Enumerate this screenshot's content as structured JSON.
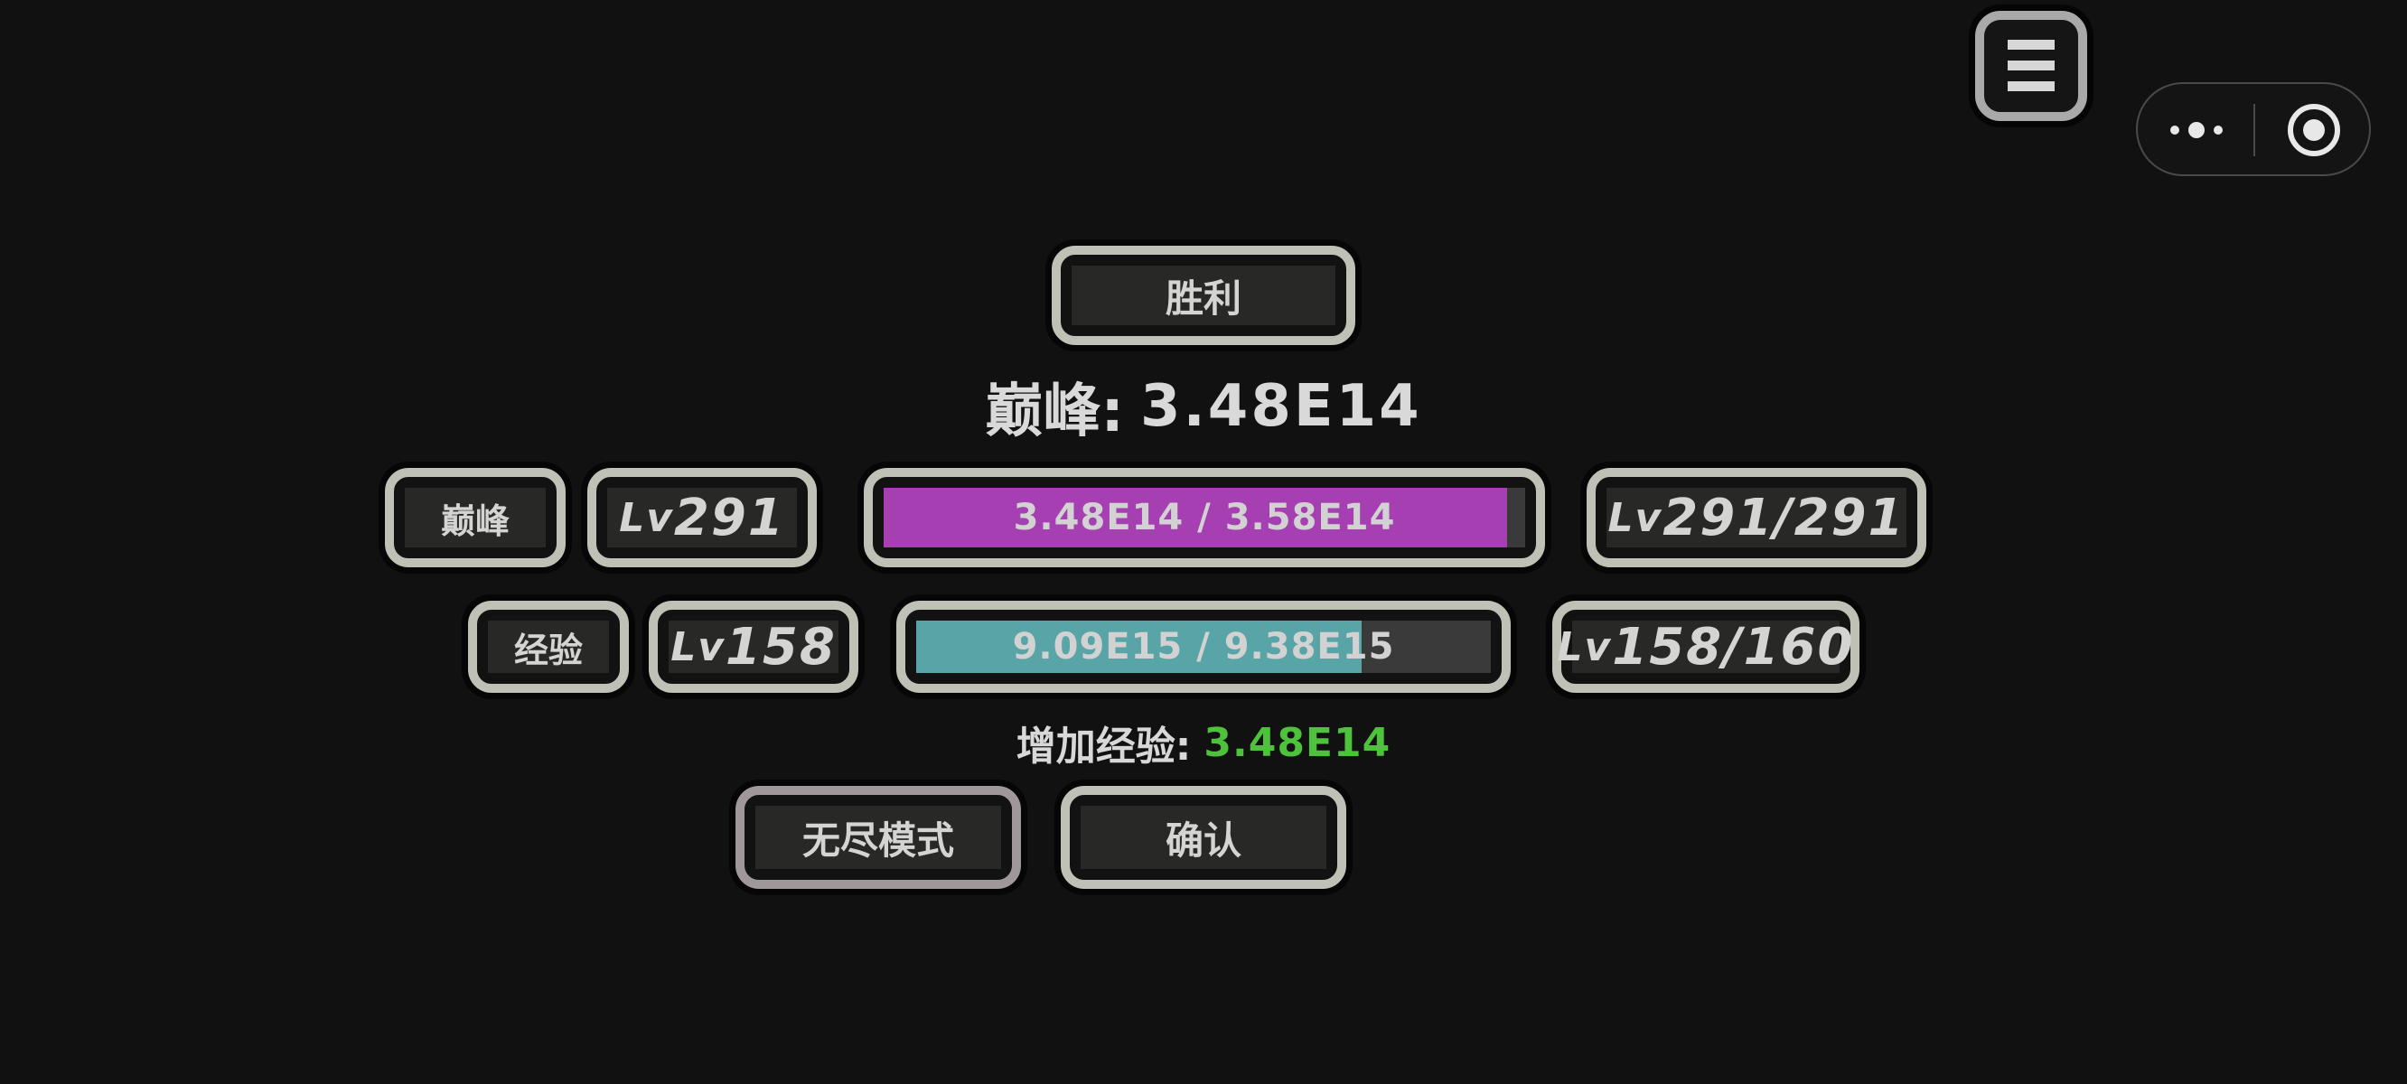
{
  "result_title": "胜利",
  "summary": {
    "label": "巅峰:",
    "value": "3.48E14"
  },
  "rows": [
    {
      "label": "巅峰",
      "level": "291",
      "progress_text": "3.48E14 / 3.58E14",
      "progress_ratio": 0.972,
      "level_range": "291/291",
      "fill_color": "#a63fb1"
    },
    {
      "label": "经验",
      "level": "158",
      "progress_text": "9.09E15 / 9.38E15",
      "progress_ratio": 0.775,
      "level_range": "158/160",
      "fill_color": "#58a4a6"
    }
  ],
  "lv_prefix": "Lv",
  "exp_gain": {
    "label": "增加经验:",
    "value": "3.48E14",
    "value_color": "#4fc23d"
  },
  "buttons": {
    "endless": "无尽模式",
    "confirm": "确认"
  },
  "icons": {
    "menu": "hamburger-menu-icon",
    "more": "more-dots-icon",
    "close": "target-circle-icon"
  }
}
